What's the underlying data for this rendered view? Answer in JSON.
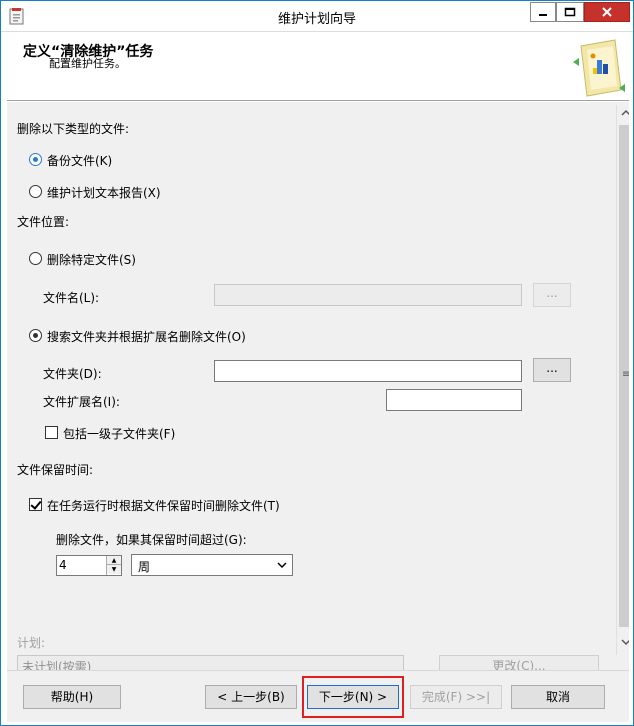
{
  "window": {
    "title": "维护计划向导"
  },
  "header": {
    "title": "定义“清除维护”任务",
    "subtitle": "配置维护任务。"
  },
  "file_type": {
    "label": "删除以下类型的文件:",
    "options": [
      {
        "label": "备份文件(K)",
        "selected": true
      },
      {
        "label": "维护计划文本报告(X)",
        "selected": false
      }
    ]
  },
  "file_location": {
    "label": "文件位置:",
    "delete_specific": {
      "label": "删除特定文件(S)",
      "selected": false
    },
    "file_name_label": "文件名(L):",
    "file_name_value": "",
    "browse_label": "...",
    "search_folder": {
      "label": "搜索文件夹并根据扩展名删除文件(O)",
      "selected": true
    },
    "folder_label": "文件夹(D):",
    "folder_value": "",
    "folder_browse_label": "...",
    "extension_label": "文件扩展名(I):",
    "extension_value": "",
    "include_subfolders": {
      "label": "包括一级子文件夹(F)",
      "checked": false
    }
  },
  "retention": {
    "label": "文件保留时间:",
    "delete_by_age": {
      "label": "在任务运行时根据文件保留时间删除文件(T)",
      "checked": true
    },
    "older_than_label": "删除文件，如果其保留时间超过(G):",
    "amount": "4",
    "unit": "周"
  },
  "schedule": {
    "label": "计划:",
    "value": "未计划(按需)",
    "change_label": "更改(C)..."
  },
  "footer": {
    "help": "帮助(H)",
    "back": "< 上一步(B)",
    "next": "下一步(N) >",
    "finish": "完成(F) >>|",
    "cancel": "取消"
  },
  "colors": {
    "window_border": "#1a7ec2",
    "close_button": "#c7312b",
    "content_bg": "#f0f0f0",
    "highlight": "#e02020",
    "radio_accent": "#2a7ad2"
  }
}
